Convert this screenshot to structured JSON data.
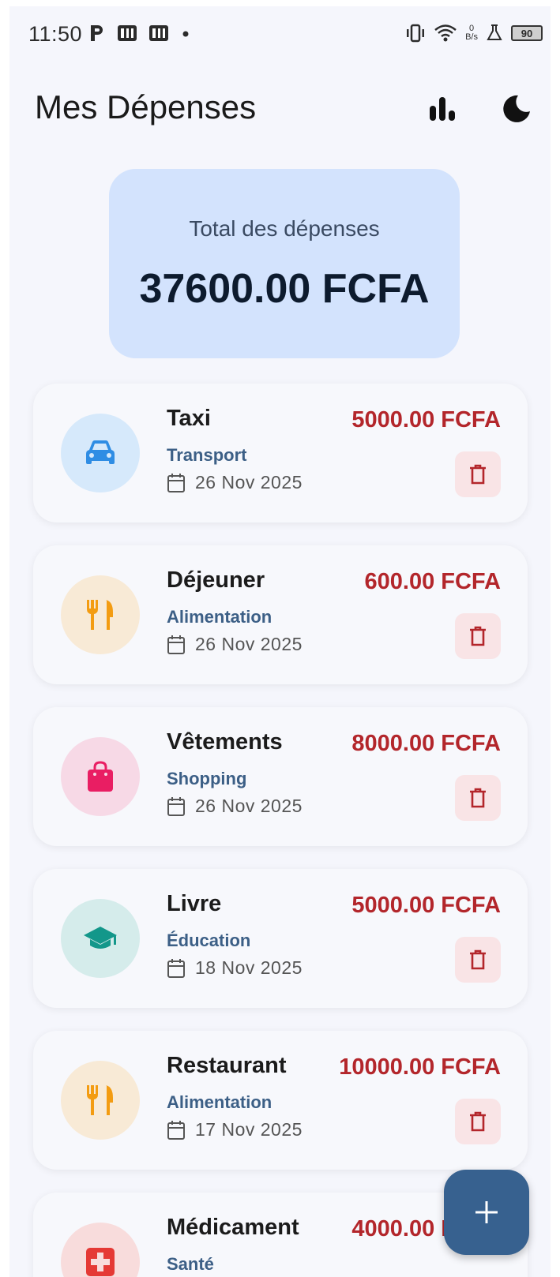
{
  "status_bar": {
    "time": "11:50",
    "network_speed_value": "0",
    "network_speed_unit": "B/s",
    "battery": "90",
    "icons": [
      "parking-icon",
      "app-icon",
      "app-icon",
      "dot-icon",
      "vibrate-icon",
      "wifi-icon",
      "flask-icon",
      "battery-icon"
    ]
  },
  "appbar": {
    "title": "Mes Dépenses",
    "actions": [
      "bar-chart-icon",
      "dark-mode-icon"
    ]
  },
  "total": {
    "label": "Total des dépenses",
    "value": "37600.00 FCFA"
  },
  "colors": {
    "amount": "#b3262b",
    "category": "#3c5f86",
    "fab": "#37618f",
    "total_card": "#d3e3fd"
  },
  "expenses": [
    {
      "title": "Taxi",
      "category": "Transport",
      "date": "26 Nov 2025",
      "amount": "5000.00 FCFA",
      "icon": "car-icon",
      "icon_color": "#2f8de4",
      "circle_color": "#d6e9fb"
    },
    {
      "title": "Déjeuner",
      "category": "Alimentation",
      "date": "26 Nov 2025",
      "amount": "600.00 FCFA",
      "icon": "restaurant-icon",
      "icon_color": "#f39c12",
      "circle_color": "#f8ead6"
    },
    {
      "title": "Vêtements",
      "category": "Shopping",
      "date": "26 Nov 2025",
      "amount": "8000.00 FCFA",
      "icon": "shopping-bag-icon",
      "icon_color": "#e91e63",
      "circle_color": "#f7d9e6"
    },
    {
      "title": "Livre",
      "category": "Éducation",
      "date": "18 Nov 2025",
      "amount": "5000.00 FCFA",
      "icon": "school-icon",
      "icon_color": "#13978a",
      "circle_color": "#d5eceb"
    },
    {
      "title": "Restaurant",
      "category": "Alimentation",
      "date": "17 Nov 2025",
      "amount": "10000.00 FCFA",
      "icon": "restaurant-icon",
      "icon_color": "#f39c12",
      "circle_color": "#f8ead6"
    },
    {
      "title": "Médicament",
      "category": "Santé",
      "date": "",
      "amount": "4000.00 FCFA",
      "icon": "medical-icon",
      "icon_color": "#e53935",
      "circle_color": "#f8dcdc"
    }
  ],
  "fab": {
    "icon": "add-icon"
  }
}
